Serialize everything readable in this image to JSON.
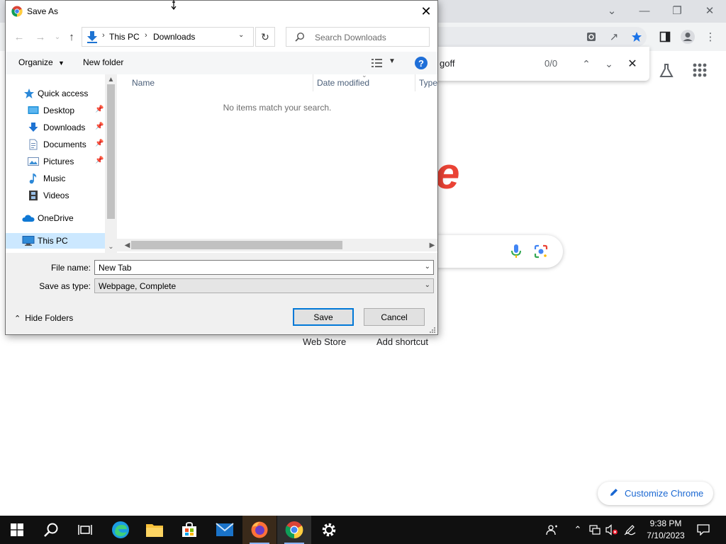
{
  "dialog": {
    "title": "Save As",
    "address": {
      "segments": [
        "This PC",
        "Downloads"
      ]
    },
    "search_placeholder": "Search Downloads",
    "toolbar": {
      "organize_label": "Organize",
      "new_folder_label": "New folder"
    },
    "nav_pane": {
      "items": [
        {
          "label": "Quick access",
          "icon": "star-icon",
          "pinned": false
        },
        {
          "label": "Desktop",
          "icon": "desktop-folder-icon",
          "pinned": true
        },
        {
          "label": "Downloads",
          "icon": "downloads-folder-icon",
          "pinned": true
        },
        {
          "label": "Documents",
          "icon": "documents-folder-icon",
          "pinned": true
        },
        {
          "label": "Pictures",
          "icon": "pictures-folder-icon",
          "pinned": true
        },
        {
          "label": "Music",
          "icon": "music-icon",
          "pinned": false
        },
        {
          "label": "Videos",
          "icon": "videos-icon",
          "pinned": false
        },
        {
          "label": "OneDrive",
          "icon": "onedrive-icon",
          "pinned": false
        },
        {
          "label": "This PC",
          "icon": "this-pc-icon",
          "pinned": false,
          "selected": true
        }
      ]
    },
    "columns": [
      "Name",
      "Date modified",
      "Type"
    ],
    "empty_message": "No items match your search.",
    "file_name_label": "File name:",
    "file_name_value": "New Tab",
    "save_type_label": "Save as type:",
    "save_type_value": "Webpage, Complete",
    "hide_folders_label": "Hide Folders",
    "save_label": "Save",
    "cancel_label": "Cancel"
  },
  "chrome": {
    "find_text": "goff",
    "find_count": "0/0",
    "logo_fragment": "e",
    "shortcuts": [
      "Web Store",
      "Add shortcut"
    ],
    "customize_label": "Customize Chrome"
  },
  "taskbar": {
    "apps": [
      "start-icon",
      "search-icon",
      "task-view-icon",
      "edge-icon",
      "file-explorer-icon",
      "store-icon",
      "mail-icon",
      "firefox-icon",
      "chrome-icon",
      "settings-icon"
    ],
    "clock_time": "9:38 PM",
    "clock_date": "7/10/2023"
  },
  "colors": {
    "accent": "#0078d7",
    "selection": "#cce8ff",
    "chrome_red": "#ea4335",
    "link_blue": "#1967d2",
    "taskbar": "#101010"
  }
}
